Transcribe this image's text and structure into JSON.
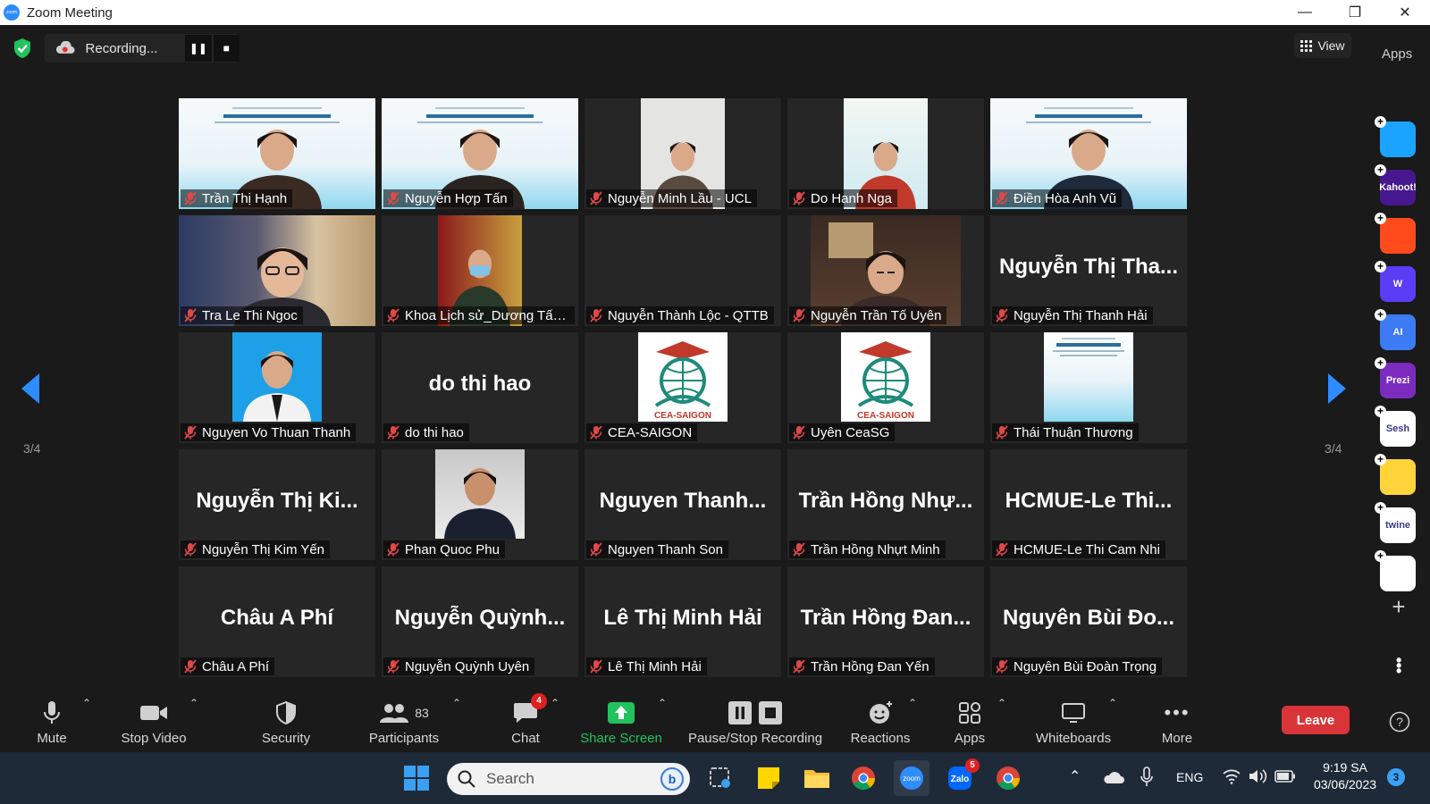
{
  "window": {
    "title": "Zoom Meeting",
    "app_icon": "zoom",
    "controls": [
      "minimize-icon",
      "restore-icon",
      "close-icon"
    ]
  },
  "topbar": {
    "recording_label": "Recording...",
    "view_label": "View",
    "apps_label": "Apps"
  },
  "pagination": {
    "left": "3/4",
    "right": "3/4"
  },
  "participants": [
    {
      "name": "Trần Thị Hạnh",
      "video": "slide",
      "person_color": "#3a2a22"
    },
    {
      "name": "Nguyễn Hợp Tấn",
      "video": "slide",
      "person_color": "#2a2420"
    },
    {
      "name": "Nguyễn Minh Lầu - UCL",
      "video": "narrow-light",
      "person_color": "#5a4a40"
    },
    {
      "name": "Do Hanh Nga",
      "video": "narrow-slide",
      "person_color": "#c0392b"
    },
    {
      "name": "Điền Hòa Anh Vũ",
      "video": "slide",
      "person_color": "#1f2a3a"
    },
    {
      "name": "Tra Le Thi Ngoc",
      "video": "room",
      "person_color": "#2a2a30"
    },
    {
      "name": "Khoa Lịch sử_Dương Tấn ...",
      "video": "narrow-flag",
      "person_color": "#2a3a2a"
    },
    {
      "name": "Nguyễn Thành Lộc - QTTB",
      "video": "none",
      "big": ""
    },
    {
      "name": "Nguyễn Trần Tố Uyên",
      "video": "narrow-room",
      "person_color": "#3a2a28"
    },
    {
      "name": "Nguyễn Thị Thanh Hải",
      "video": "none",
      "big": "Nguyễn Thị Tha..."
    },
    {
      "name": "Nguyen Vo Thuan Thanh",
      "video": "portrait-blue",
      "person_color": "#1a1a1a"
    },
    {
      "name": "do thi hao",
      "video": "none",
      "big": "do thi hao"
    },
    {
      "name": "CEA-SAIGON",
      "video": "logo",
      "logo_text": "CEA-SAIGON"
    },
    {
      "name": "Uyên CeaSG",
      "video": "logo",
      "logo_text": "CEA-SAIGON"
    },
    {
      "name": "Thái Thuận Thương",
      "video": "narrow-slide-only"
    },
    {
      "name": "Nguyễn Thị Kim Yến",
      "video": "none",
      "big": "Nguyễn Thị Ki..."
    },
    {
      "name": "Phan Quoc Phu",
      "video": "portrait-dark",
      "person_color": "#1a1a1a"
    },
    {
      "name": "Nguyen Thanh Son",
      "video": "none",
      "big": "Nguyen Thanh..."
    },
    {
      "name": "Trần Hồng Nhựt Minh",
      "video": "none",
      "big": "Trần Hồng Nhự..."
    },
    {
      "name": "HCMUE-Le Thi Cam Nhi",
      "video": "none",
      "big": "HCMUE-Le Thi..."
    },
    {
      "name": "Châu A Phí",
      "video": "none",
      "big": "Châu A Phí"
    },
    {
      "name": "Nguyễn Quỳnh Uyên",
      "video": "none",
      "big": "Nguyễn Quỳnh..."
    },
    {
      "name": "Lê Thị Minh Hải",
      "video": "none",
      "big": "Lê Thị Minh Hải"
    },
    {
      "name": "Trần Hồng Đan Yến",
      "video": "none",
      "big": "Trần Hồng Đan..."
    },
    {
      "name": "Nguyên Bùi Đoàn Trọng",
      "video": "none",
      "big": "Nguyên Bùi Đo..."
    }
  ],
  "side_apps": [
    {
      "name": "app-1",
      "label": "",
      "color": "#1aa3ff"
    },
    {
      "name": "kahoot",
      "label": "Kahoot!",
      "color": "#46178f"
    },
    {
      "name": "app-3",
      "label": "",
      "color": "#ff4a1c"
    },
    {
      "name": "wooclap",
      "label": "W",
      "color": "#5b3df5"
    },
    {
      "name": "app-5",
      "label": "AI",
      "color": "#3d7bf5"
    },
    {
      "name": "prezi",
      "label": "Prezi",
      "color": "#7b2cbf"
    },
    {
      "name": "sesh",
      "label": "Sesh",
      "color": "#ffffff"
    },
    {
      "name": "app-8",
      "label": "",
      "color": "#ffd43b"
    },
    {
      "name": "twine",
      "label": "twine",
      "color": "#ffffff"
    },
    {
      "name": "app-10",
      "label": "",
      "color": "#ffffff"
    }
  ],
  "toolbar": {
    "mute": "Mute",
    "stop_video": "Stop Video",
    "security": "Security",
    "participants": "Participants",
    "participants_count": "83",
    "chat": "Chat",
    "chat_badge": "4",
    "share_screen": "Share Screen",
    "pause_stop_recording": "Pause/Stop Recording",
    "reactions": "Reactions",
    "apps": "Apps",
    "whiteboards": "Whiteboards",
    "more": "More",
    "leave": "Leave"
  },
  "taskbar": {
    "search_placeholder": "Search",
    "zalo_badge": "5",
    "language": "ENG",
    "time": "9:19 SA",
    "date": "03/06/2023",
    "notification_count": "3"
  },
  "colors": {
    "zoom_blue": "#2D8CFF",
    "leave_red": "#d93438",
    "share_green": "#22c35e",
    "mic_muted_red": "#e04848"
  }
}
